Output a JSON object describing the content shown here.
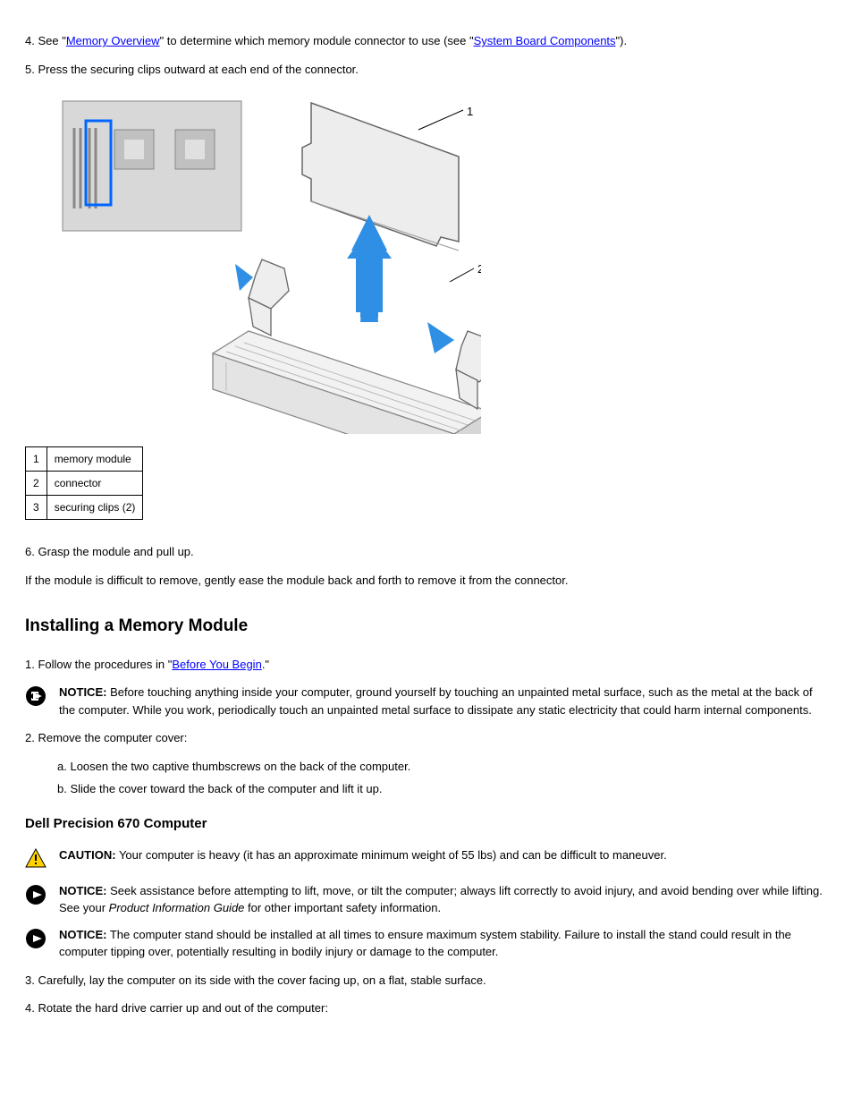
{
  "step4": {
    "num": "4.",
    "prefix": "See \"",
    "link1": "Memory Overview",
    "mid": "\" to determine which memory module connector to use (see \"",
    "link2": "System Board Components",
    "suffix": "\")."
  },
  "step5": {
    "num": "5.",
    "text": "Press the securing clips outward at each end of the connector."
  },
  "legend": {
    "r1n": "1",
    "r1t": "memory module",
    "r2n": "2",
    "r2t": "connector",
    "r3n": "3",
    "r3t": "securing clips (2)"
  },
  "step6": {
    "num": "6.",
    "text": "Grasp the module and pull up."
  },
  "step6_note": "If the module is difficult to remove, gently ease the module back and forth to remove it from the connector.",
  "heading_install": "Installing a Memory Module",
  "step_i1": {
    "num": "1.",
    "prefix": "Follow the procedures in \"",
    "link": "Before You Begin",
    "suffix": ".\""
  },
  "notice1": {
    "label": "NOTICE:",
    "text": "Before touching anything inside your computer, ground yourself by touching an unpainted metal surface, such as the metal at the back of the computer. While you work, periodically touch an unpainted metal surface to dissipate any static electricity that could harm internal components."
  },
  "step_i2": {
    "num": "2.",
    "text": "Remove the computer cover:"
  },
  "sub_a": {
    "num": "a.",
    "text": "Loosen the two captive thumbscrews on the back of the computer."
  },
  "sub_b": {
    "num": "b.",
    "text": "Slide the cover toward the back of the computer and lift it up."
  },
  "subheading_670": "Dell Precision 670 Computer",
  "caution": {
    "label": "CAUTION:",
    "text": "Your computer is heavy (it has an approximate minimum weight of 55 lbs) and can be difficult to maneuver."
  },
  "notice2": {
    "label": "NOTICE:",
    "text1": "Seek assistance before attempting to lift, move, or tilt the computer; always lift correctly to avoid injury, and avoid bending over while lifting. See your ",
    "italic": "Product Information Guide",
    "text2": " for other important safety information."
  },
  "notice3": {
    "label": "NOTICE:",
    "text": "The computer stand should be installed at all times to ensure maximum system stability. Failure to install the stand could result in the computer tipping over, potentially resulting in bodily injury or damage to the computer."
  },
  "step_670_3": {
    "num": "3.",
    "text": "Carefully, lay the computer on its side with the cover facing up, on a flat, stable surface."
  },
  "step_670_4": {
    "num": "4.",
    "text": "Rotate the hard drive carrier up and out of the computer:"
  }
}
